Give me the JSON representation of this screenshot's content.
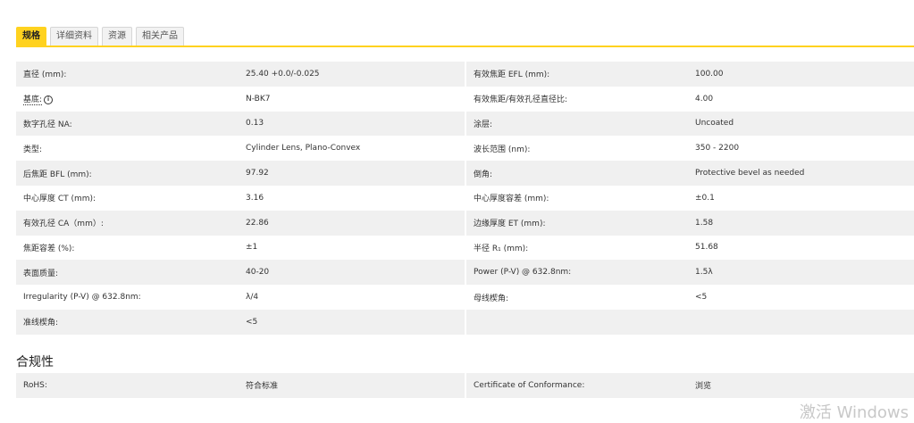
{
  "tabs": [
    "规格",
    "详细资料",
    "资源",
    "相关产品"
  ],
  "specs": [
    [
      "直径 (mm):",
      "25.40 +0.0/-0.025",
      "有效焦距 EFL (mm):",
      "100.00"
    ],
    [
      "基底:",
      "N-BK7",
      "有效焦距/有效孔径直径比:",
      "4.00"
    ],
    [
      "数字孔径 NA:",
      "0.13",
      "涂层:",
      "Uncoated"
    ],
    [
      "类型:",
      "Cylinder Lens, Plano-Convex",
      "波长范围 (nm):",
      "350 - 2200"
    ],
    [
      "后焦距 BFL (mm):",
      "97.92",
      "倒角:",
      "Protective bevel as needed"
    ],
    [
      "中心厚度 CT (mm):",
      "3.16",
      "中心厚度容差 (mm):",
      "±0.1"
    ],
    [
      "有效孔径 CA（mm）:",
      "22.86",
      "边缘厚度 ET (mm):",
      "1.58"
    ],
    [
      "焦距容差 (%):",
      "±1",
      "半径 R₁ (mm):",
      "51.68"
    ],
    [
      "表面质量:",
      "40-20",
      "Power (P-V) @ 632.8nm:",
      "1.5λ"
    ],
    [
      "Irregularity (P-V) @ 632.8nm:",
      "λ/4",
      "母线楔角:",
      "<5"
    ],
    [
      "准线楔角:",
      "<5",
      "",
      ""
    ]
  ],
  "compliance_title": "合规性",
  "compliance": [
    "RoHS:",
    "符合标准",
    "Certificate of Conformance:",
    "浏览"
  ],
  "info_icon_glyph": "i",
  "watermark": "激活 Windows"
}
